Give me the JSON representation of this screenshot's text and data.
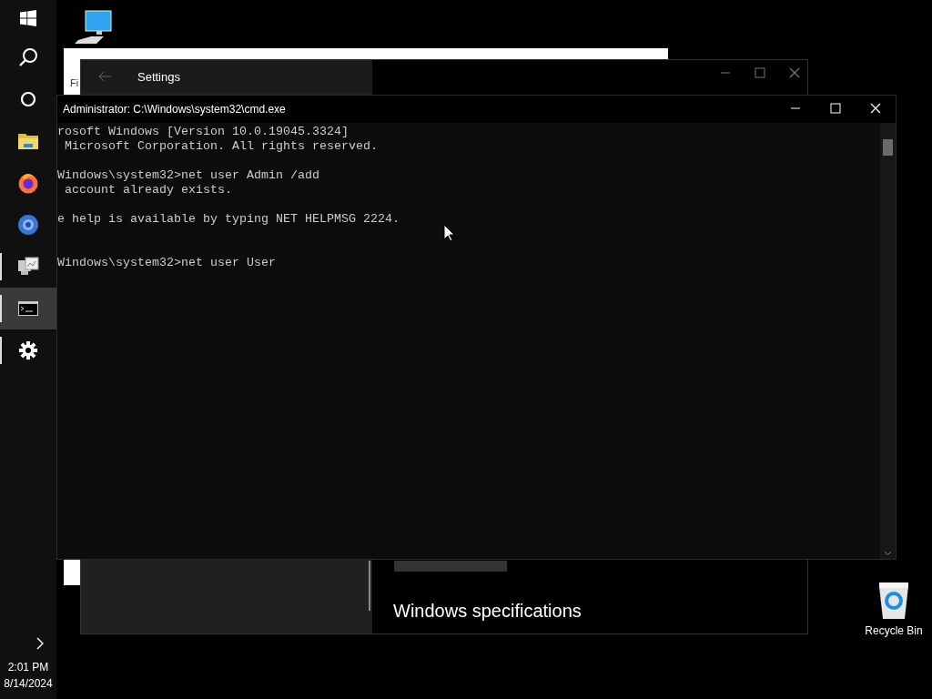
{
  "taskbar": {
    "items": [
      {
        "kind": "start",
        "running": false,
        "selected": false
      },
      {
        "kind": "search",
        "running": false,
        "selected": false
      },
      {
        "kind": "circle",
        "running": false,
        "selected": false
      },
      {
        "kind": "folder",
        "running": false,
        "selected": false
      },
      {
        "kind": "firefox",
        "running": false,
        "selected": false
      },
      {
        "kind": "browser",
        "running": false,
        "selected": false
      },
      {
        "kind": "monitors",
        "running": true,
        "selected": false
      },
      {
        "kind": "terminal",
        "running": true,
        "selected": true
      },
      {
        "kind": "gear",
        "running": true,
        "selected": false
      }
    ],
    "clock": {
      "time": "2:01 PM",
      "date": "8/14/2024"
    }
  },
  "desktop_icons": [
    {
      "kind": "computer"
    },
    {
      "kind": "recycle_bin",
      "label": "Recycle Bin"
    }
  ],
  "explorer_window": {
    "text": "Fi"
  },
  "settings_window": {
    "title": "Settings",
    "heading": "Windows specifications"
  },
  "cmd_window": {
    "title": "Administrator: C:\\Windows\\system32\\cmd.exe",
    "blocks": [
      [
        "rosoft Windows [Version 10.0.19045.3324]",
        " Microsoft Corporation. All rights reserved."
      ],
      [
        "Windows\\system32>net user Admin /add",
        " account already exists."
      ],
      [
        "e help is available by typing NET HELPMSG 2224."
      ],
      [
        "Windows\\system32>net user User"
      ]
    ]
  }
}
